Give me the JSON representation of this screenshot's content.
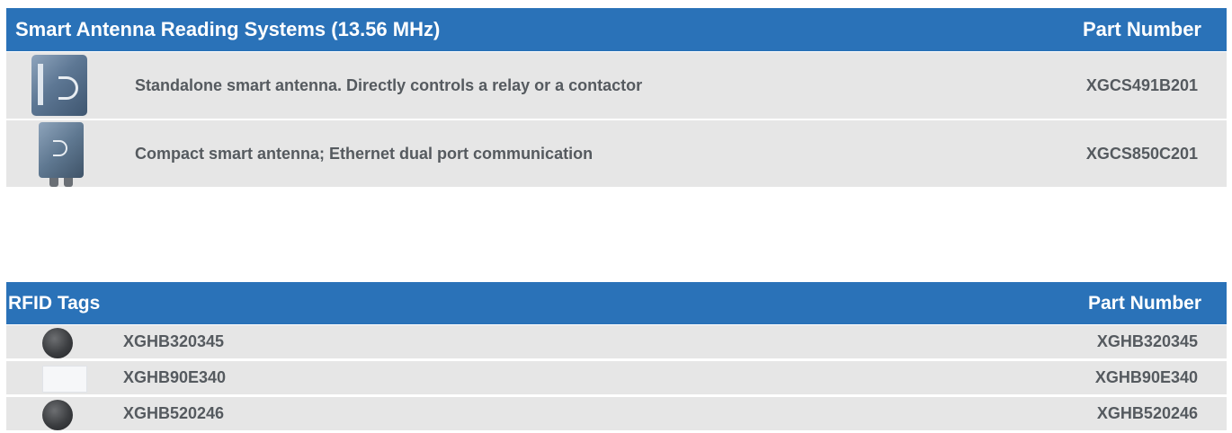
{
  "table1": {
    "header_title": "Smart Antenna Reading Systems (13.56 MHz)",
    "header_part": "Part Number",
    "rows": [
      {
        "image": "smart-antenna-standalone-image",
        "description": "Standalone smart antenna. Directly controls a relay or a contactor",
        "part": "XGCS491B201"
      },
      {
        "image": "smart-antenna-compact-image",
        "description": "Compact smart antenna; Ethernet dual port communication",
        "part": "XGCS850C201"
      }
    ]
  },
  "table2": {
    "header_title": "RFID Tags",
    "header_part": "Part Number",
    "rows": [
      {
        "image": "rfid-disc-tag-image",
        "description": "XGHB320345",
        "part": "XGHB320345"
      },
      {
        "image": "rfid-card-tag-image",
        "description": "XGHB90E340",
        "part": "XGHB90E340"
      },
      {
        "image": "rfid-disc-tag-image",
        "description": "XGHB520246",
        "part": "XGHB520246"
      }
    ]
  },
  "colors": {
    "header_bg": "#2a72b8",
    "row_bg": "#e6e6e6",
    "row_text": "#555a5f"
  }
}
